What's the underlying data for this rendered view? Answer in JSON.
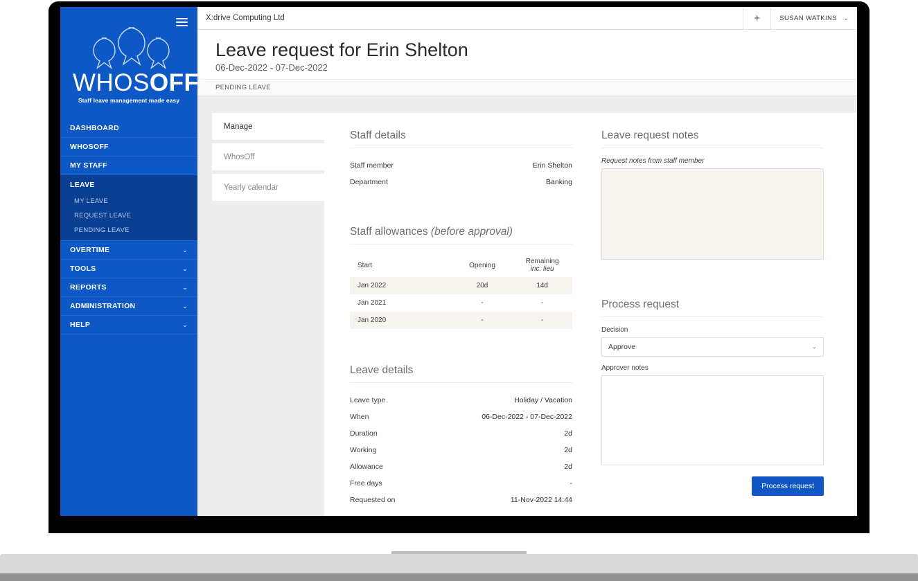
{
  "sidebar": {
    "logo": {
      "word_thin": "WHOS",
      "word_bold": "OFF",
      "registered": "®",
      "tagline": "Staff leave management made easy"
    },
    "menu_icon": "hamburger-icon",
    "items": [
      {
        "label": "DASHBOARD",
        "chevron": ""
      },
      {
        "label": "WHOSOFF",
        "chevron": ""
      },
      {
        "label": "MY STAFF",
        "chevron": ""
      }
    ],
    "group": {
      "label": "LEAVE",
      "subitems": [
        {
          "label": "MY LEAVE"
        },
        {
          "label": "REQUEST LEAVE"
        },
        {
          "label": "PENDING LEAVE"
        }
      ]
    },
    "items_after": [
      {
        "label": "OVERTIME",
        "chevron": "⌄"
      },
      {
        "label": "TOOLS",
        "chevron": "⌄"
      },
      {
        "label": "REPORTS",
        "chevron": "⌄"
      },
      {
        "label": "ADMINISTRATION",
        "chevron": "⌄"
      },
      {
        "label": "HELP",
        "chevron": "⌄"
      }
    ]
  },
  "topbar": {
    "company": "X:drive Computing Ltd",
    "add_icon": "+",
    "user_name": "SUSAN WATKINS",
    "user_chevron": "⌄"
  },
  "page": {
    "title": "Leave request for Erin Shelton",
    "subtitle": "06-Dec-2022 - 07-Dec-2022",
    "breadcrumb": "PENDING LEAVE"
  },
  "tabs": [
    {
      "label": "Manage",
      "active": true
    },
    {
      "label": "WhosOff",
      "active": false
    },
    {
      "label": "Yearly calendar",
      "active": false
    }
  ],
  "staff_details": {
    "title": "Staff details",
    "rows": [
      {
        "label": "Staff member",
        "value": "Erin Shelton"
      },
      {
        "label": "Department",
        "value": "Banking"
      }
    ]
  },
  "staff_allowances": {
    "title_main": "Staff allowances ",
    "title_em": "(before approval)",
    "headers": {
      "start": "Start",
      "opening": "Opening",
      "remaining_main": "Remaining ",
      "remaining_em": "inc. lieu"
    },
    "rows": [
      {
        "start": "Jan 2022",
        "opening": "20d",
        "remaining": "14d"
      },
      {
        "start": "Jan 2021",
        "opening": "-",
        "remaining": "-"
      },
      {
        "start": "Jan 2020",
        "opening": "-",
        "remaining": "-"
      }
    ]
  },
  "leave_details": {
    "title": "Leave details",
    "rows": [
      {
        "label": "Leave type",
        "value": "Holiday / Vacation"
      },
      {
        "label": "When",
        "value": "06-Dec-2022 - 07-Dec-2022"
      },
      {
        "label": "Duration",
        "value": "2d"
      },
      {
        "label": "Working",
        "value": "2d"
      },
      {
        "label": "Allowance",
        "value": "2d"
      },
      {
        "label": "Free days",
        "value": "-"
      },
      {
        "label": "Requested on",
        "value": "11-Nov-2022 14:44"
      }
    ]
  },
  "leave_request_notes": {
    "title": "Leave request notes",
    "label": "Request notes from staff member",
    "value": "",
    "placeholder": ""
  },
  "process_request": {
    "title": "Process request",
    "decision_label": "Decision",
    "decision_value": "Approve",
    "decision_options": [
      "Approve"
    ],
    "decision_chevron": "⌄",
    "notes_label": "Approver notes",
    "notes_value": "",
    "notes_placeholder": "",
    "submit_label": "Process request"
  },
  "colors": {
    "sidebar_blue": "#0d58c4",
    "sidebar_group_navy": "#0b3f94",
    "primary_button": "#1057c4",
    "content_bg": "#ededed",
    "readonly_field": "#f7f4f0"
  }
}
